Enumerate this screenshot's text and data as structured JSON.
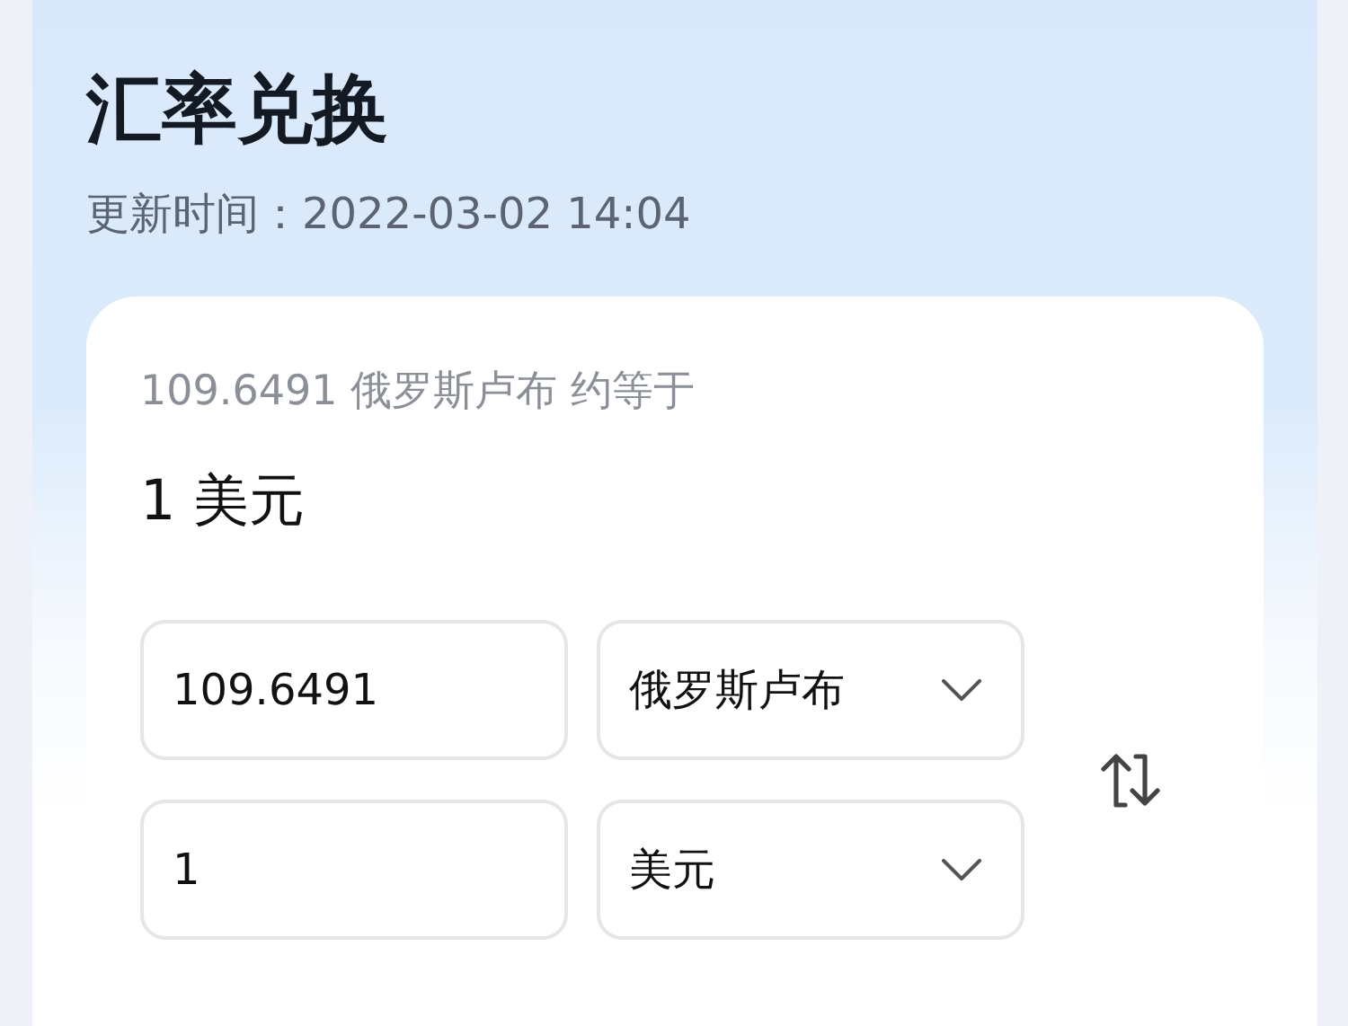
{
  "title": "汇率兑换",
  "updated": "更新时间：2022-03-02 14:04",
  "summary": "109.6491 俄罗斯卢布 约等于",
  "result": "1 美元",
  "rows": [
    {
      "amount": "109.6491",
      "currency": "俄罗斯卢布"
    },
    {
      "amount": "1",
      "currency": "美元"
    }
  ]
}
